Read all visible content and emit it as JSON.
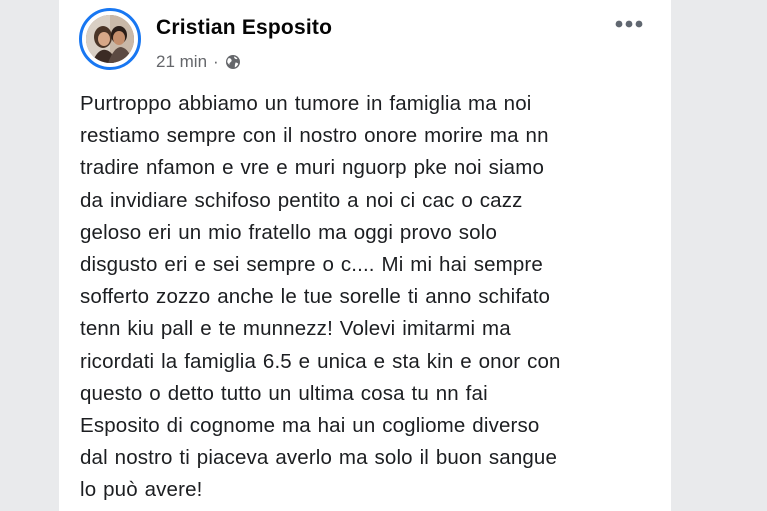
{
  "post": {
    "author": "Cristian Esposito",
    "time": "21 min",
    "separator": "·",
    "privacy_icon": "globe-icon",
    "more_icon": "more-options-icon",
    "avatar": "profile-photo",
    "lines": [
      "Purtroppo abbiamo un tumore in famiglia ma noi",
      "restiamo sempre con il nostro onore morire ma nn",
      "tradire nfamon e vre e muri nguorp pke noi siamo",
      "da invidiare schifoso pentito a noi ci cac o cazz",
      "geloso eri un mio fratello ma oggi provo solo",
      "disgusto eri e sei sempre o c.... Mi mi hai sempre",
      "sofferto zozzo anche le tue sorelle ti anno schifato",
      "tenn kiu pall e te munnezz! Volevi imitarmi ma",
      "ricordati la famiglia 6.5 e unica e sta kin e onor con",
      "questo o detto tutto un ultima cosa tu nn fai",
      "Esposito di cognome ma hai un cogliome diverso",
      "dal nostro ti piaceva averlo ma solo il buon sangue",
      "lo può avere!"
    ]
  },
  "colors": {
    "accent": "#1877f2",
    "text": "#1c1e21",
    "muted": "#65676b",
    "background": "#e9eaec",
    "card": "#ffffff"
  }
}
